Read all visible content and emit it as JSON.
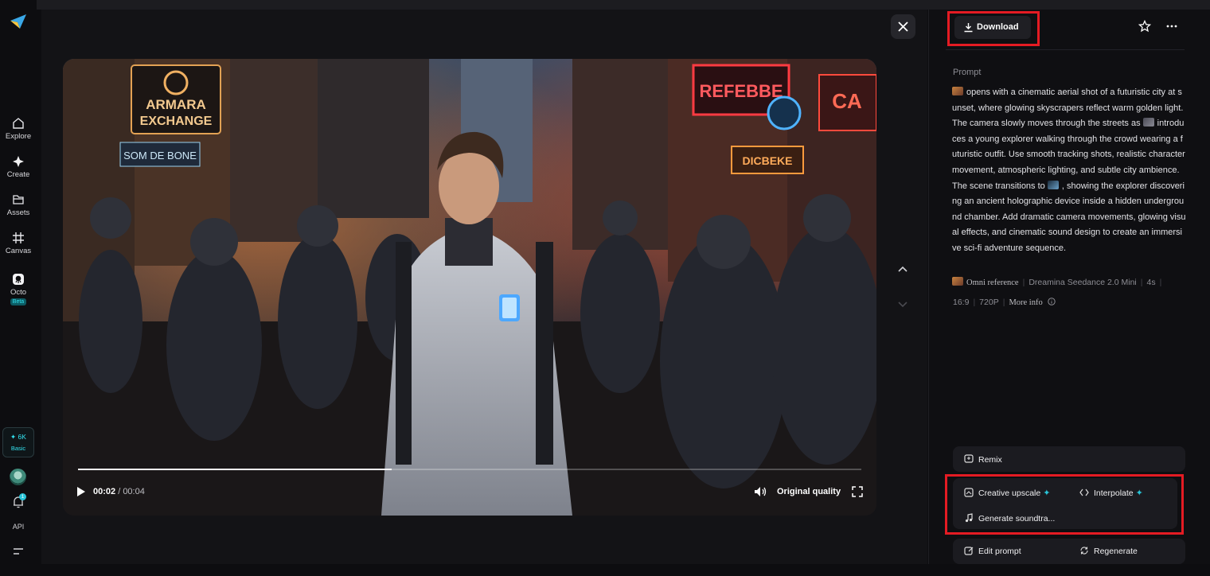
{
  "sidebar": {
    "items": [
      {
        "label": "Explore",
        "icon": "home-icon"
      },
      {
        "label": "Create",
        "icon": "sparkle-icon"
      },
      {
        "label": "Assets",
        "icon": "folder-icon"
      },
      {
        "label": "Canvas",
        "icon": "canvas-icon"
      },
      {
        "label": "Octo",
        "icon": "octo-icon",
        "badge": "Beta"
      }
    ],
    "credits": {
      "value": "✦ 6K",
      "plan": "Basic"
    },
    "notification_count": "1",
    "api_label": "API"
  },
  "player": {
    "current_time": "00:02",
    "separator": " / ",
    "duration": "00:04",
    "progress": 0.4,
    "quality_label": "Original quality"
  },
  "panel": {
    "download_label": "Download",
    "prompt_label": "Prompt",
    "prompt": {
      "part1": "opens with a cinematic aerial shot of a futuristic city at sunset, where glowing skyscrapers reflect warm golden light. The camera slowly moves through the streets as ",
      "part2": "introduces a young explorer walking through the crowd wearing a futuristic outfit. Use smooth tracking shots, realistic character movement, atmospheric lighting, and subtle city ambience. The scene transitions to ",
      "part3": ", showing the explorer discovering an ancient holographic device inside a hidden underground chamber. Add dramatic camera movements, glowing visual effects, and cinematic sound design to create an immersive sci-fi adventure sequence."
    },
    "meta": {
      "reference": "Omni reference",
      "model": "Dreamina Seedance 2.0 Mini",
      "length": "4s",
      "ratio": "16:9",
      "resolution": "720P",
      "more_info": "More info"
    },
    "actions": {
      "remix": "Remix",
      "creative_upscale": "Creative upscale",
      "interpolate": "Interpolate",
      "generate_soundtrack": "Generate soundtra...",
      "edit_prompt": "Edit prompt",
      "regenerate": "Regenerate"
    }
  },
  "colors": {
    "accent": "#29c4d8",
    "highlight": "#e41b23",
    "background": "#0d0d10"
  }
}
